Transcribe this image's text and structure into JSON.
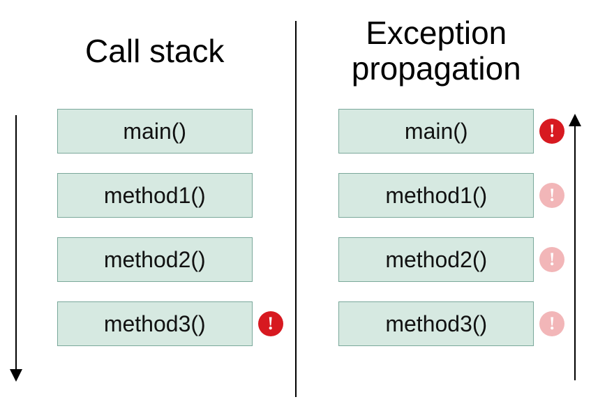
{
  "left": {
    "title": "Call stack",
    "frames": [
      {
        "label": "main()",
        "badge": null
      },
      {
        "label": "method1()",
        "badge": null
      },
      {
        "label": "method2()",
        "badge": null
      },
      {
        "label": "method3()",
        "badge": {
          "glyph": "!",
          "style": "solid"
        }
      }
    ],
    "arrow_direction": "down"
  },
  "right": {
    "title": "Exception propagation",
    "frames": [
      {
        "label": "main()",
        "badge": {
          "glyph": "!",
          "style": "solid"
        }
      },
      {
        "label": "method1()",
        "badge": {
          "glyph": "!",
          "style": "faded"
        }
      },
      {
        "label": "method2()",
        "badge": {
          "glyph": "!",
          "style": "faded"
        }
      },
      {
        "label": "method3()",
        "badge": {
          "glyph": "!",
          "style": "faded"
        }
      }
    ],
    "arrow_direction": "up"
  },
  "colors": {
    "frame_fill": "#d6e9e1",
    "frame_border": "#7aa89a",
    "badge_solid": "#d71920",
    "badge_faded": "#f2b6b8"
  }
}
